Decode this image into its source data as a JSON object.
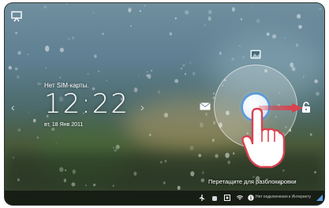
{
  "lockscreen": {
    "sim_status": "Нет SIM-карты.",
    "time": "12:22",
    "date": "вт, 18 Янв 2011",
    "unlock_hint": "Перетащите для разблокировки"
  },
  "status_bar": {
    "network_text": "Нет подключения к Интернету"
  },
  "icons": {
    "top_left": "cast-screen-icon",
    "ring_top": "gallery-icon",
    "ring_left": "mail-icon",
    "ring_right": "unlock-padlock-icon",
    "pointer": "pointing-hand-icon",
    "arrow": "swipe-right-arrow-icon"
  },
  "colors": {
    "arrow": "#d9424f",
    "handle_ring": "#4f96dc",
    "status_bar": "#000000"
  }
}
